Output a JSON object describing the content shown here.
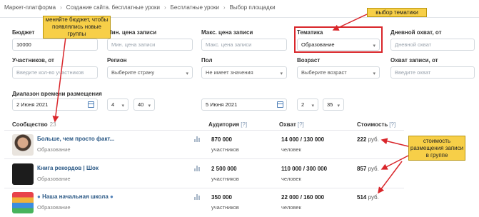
{
  "breadcrumb": [
    "Маркет-платформа",
    "Создание сайта. бесплатные уроки",
    "Бесплатные уроки",
    "Выбор площадки"
  ],
  "filters": {
    "budget": {
      "label": "Бюджет",
      "value": "10000"
    },
    "min_price": {
      "label": "Мин. цена записи",
      "placeholder": "Мин. цена записи"
    },
    "max_price": {
      "label": "Макс. цена записи",
      "placeholder": "Макс. цена записи"
    },
    "topic": {
      "label": "Тематика",
      "value": "Образование"
    },
    "daily_reach": {
      "label": "Дневной охват, от",
      "placeholder": "Дневной охват"
    },
    "members": {
      "label": "Участников, от",
      "placeholder": "Введите кол-во участников"
    },
    "region": {
      "label": "Регион",
      "value": "Выберите страну"
    },
    "gender": {
      "label": "Пол",
      "value": "Не имеет значения"
    },
    "age": {
      "label": "Возраст",
      "value": "Выберите возраст"
    },
    "post_reach": {
      "label": "Охват записи, от",
      "placeholder": "Введите охват"
    },
    "time_range": {
      "label": "Диапазон времени размещения",
      "from_date": "2 Июня 2021",
      "from_hour": "4",
      "from_min": "40",
      "to_date": "5 Июня 2021",
      "to_hour": "2",
      "to_min": "35"
    }
  },
  "table": {
    "headers": {
      "community": "Сообщество",
      "community_count": "23",
      "audience": "Аудитория",
      "reach": "Охват",
      "cost": "Стоимость",
      "help": "[?]"
    },
    "rows": [
      {
        "name": "Больше, чем просто факт...",
        "category": "Образование",
        "audience": "870 000",
        "audience_unit": "участников",
        "reach": "14 000 / 130 000",
        "reach_unit": "человек",
        "price": "222",
        "currency": "руб."
      },
      {
        "name": "Книга рекордов | Шок",
        "category": "Образование",
        "audience": "2 500 000",
        "audience_unit": "участников",
        "reach": "110 000 / 300 000",
        "reach_unit": "человек",
        "price": "857",
        "currency": "руб."
      },
      {
        "name": "Наша начальная школа",
        "category": "Образование",
        "audience": "350 000",
        "audience_unit": "участников",
        "reach": "22 000 / 160 000",
        "reach_unit": "человек",
        "price": "514",
        "currency": "руб."
      }
    ]
  },
  "annotations": {
    "budget_note": "меняйте бюджет, чтобы появлялись новые группы",
    "topic_note": "выбор тематики",
    "cost_note": "стоимость размещения записи в группе"
  },
  "colors": {
    "accent": "#2a5885",
    "annotation_bg": "#f7cf48",
    "annotation_red": "#d9262b"
  }
}
